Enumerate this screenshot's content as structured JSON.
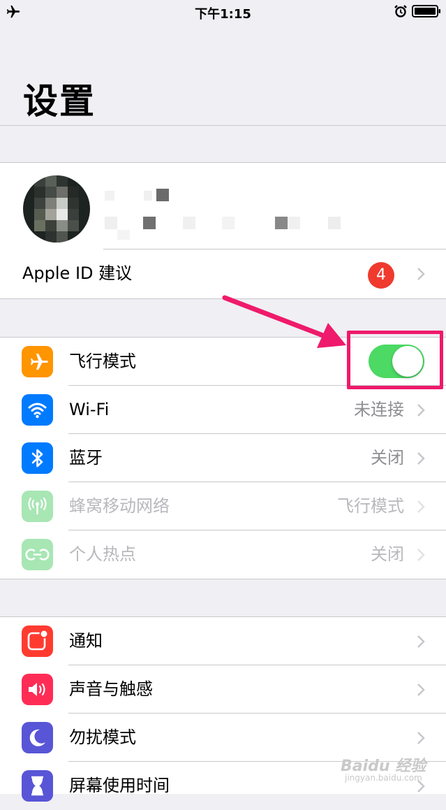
{
  "status_bar": {
    "time": "下午1:15"
  },
  "page_title": "设置",
  "profile": {
    "apple_id_label": "Apple ID 建议",
    "badge_count": "4"
  },
  "connectivity": [
    {
      "label": "飞行模式",
      "detail": "",
      "icon": "airplane-icon",
      "color": "#ff9500",
      "toggle_on": true
    },
    {
      "label": "Wi-Fi",
      "detail": "未连接",
      "icon": "wifi-icon",
      "color": "#007aff"
    },
    {
      "label": "蓝牙",
      "detail": "关闭",
      "icon": "bluetooth-icon",
      "color": "#007aff"
    },
    {
      "label": "蜂窝移动网络",
      "detail": "飞行模式",
      "icon": "cellular-antenna-icon",
      "color": "#a8e6b4",
      "disabled": true
    },
    {
      "label": "个人热点",
      "detail": "关闭",
      "icon": "hotspot-icon",
      "color": "#a8e6b4",
      "disabled": true
    }
  ],
  "general": [
    {
      "label": "通知",
      "icon": "notifications-icon",
      "color": "#ff3b30"
    },
    {
      "label": "声音与触感",
      "icon": "sound-icon",
      "color": "#ff2d55"
    },
    {
      "label": "勿扰模式",
      "icon": "moon-icon",
      "color": "#5856d6"
    },
    {
      "label": "屏幕使用时间",
      "icon": "hourglass-icon",
      "color": "#5856d6"
    }
  ],
  "annotation": {
    "highlight_color": "#ef1a6b"
  },
  "watermark": {
    "main": "Baidu 经验",
    "sub": "jingyan.baidu.com"
  }
}
